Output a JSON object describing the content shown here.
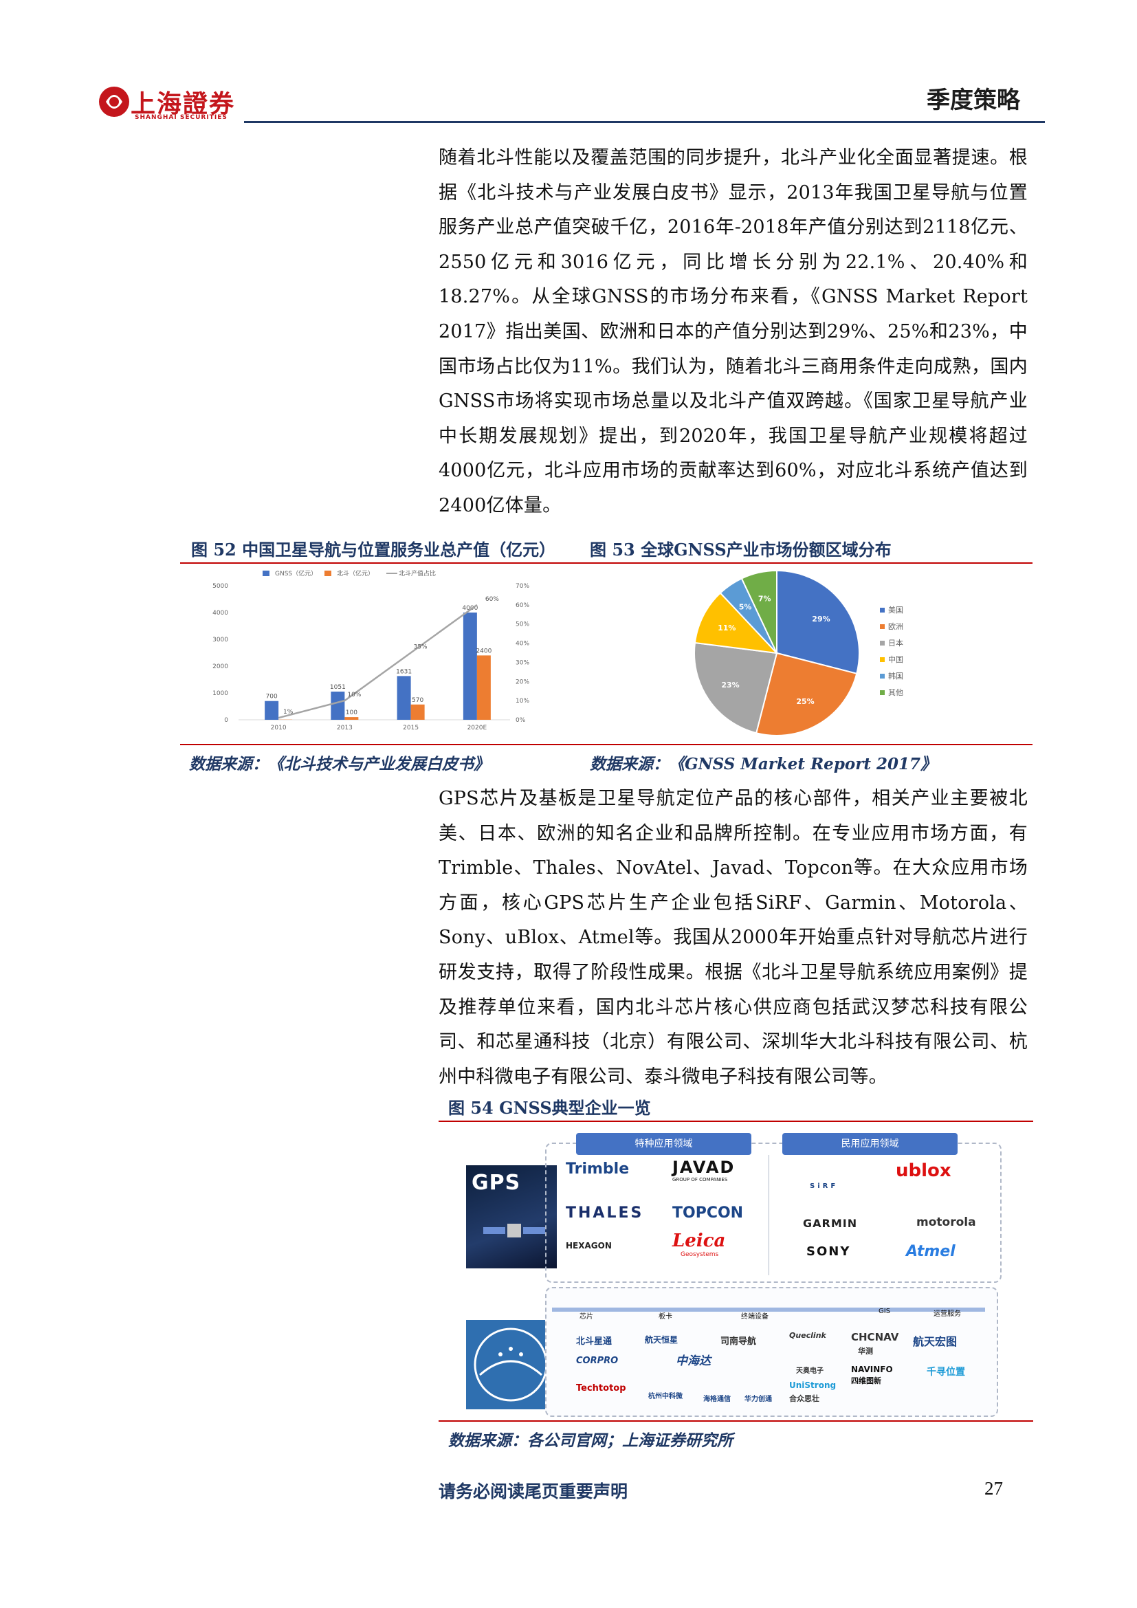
{
  "header": {
    "logo_cn": "上海證券",
    "logo_en": "SHANGHAI SECURITIES",
    "title": "季度策略"
  },
  "paragraphs": {
    "p1": "随着北斗性能以及覆盖范围的同步提升，北斗产业化全面显著提速。根据《北斗技术与产业发展白皮书》显示，2013年我国卫星导航与位置服务产业总产值突破千亿，2016年-2018年产值分别达到2118亿元、2550亿元和3016亿元，同比增长分别为22.1%、20.40%和18.27%。从全球GNSS的市场分布来看，《GNSS Market Report 2017》指出美国、欧洲和日本的产值分别达到29%、25%和23%，中国市场占比仅为11%。我们认为，随着北斗三商用条件走向成熟，国内GNSS市场将实现市场总量以及北斗产值双跨越。《国家卫星导航产业中长期发展规划》提出，到2020年，我国卫星导航产业规模将超过4000亿元，北斗应用市场的贡献率达到60%，对应北斗系统产值达到2400亿体量。",
    "p2": "GPS芯片及基板是卫星导航定位产品的核心部件，相关产业主要被北美、日本、欧洲的知名企业和品牌所控制。在专业应用市场方面，有Trimble、Thales、NovAtel、Javad、Topcon等。在大众应用市场方面，核心GPS芯片生产企业包括SiRF、Garmin、Motorola、Sony、uBlox、Atmel等。我国从2000年开始重点针对导航芯片进行研发支持，取得了阶段性成果。根据《北斗卫星导航系统应用案例》提及推荐单位来看，国内北斗芯片核心供应商包括武汉梦芯科技有限公司、和芯星通科技（北京）有限公司、深圳华大北斗科技有限公司、杭州中科微电子有限公司、泰斗微电子科技有限公司等。"
  },
  "figures": {
    "fig52_caption": "图 52 中国卫星导航与位置服务业总产值（亿元）",
    "fig53_caption": "图 53 全球GNSS产业市场份额区域分布",
    "fig52_source": "数据来源：《北斗技术与产业发展白皮书》",
    "fig53_source": "数据来源：《GNSS Market Report 2017》",
    "fig54_caption": "图 54 GNSS典型企业一览",
    "fig54_source": "数据来源：各公司官网；上海证券研究所"
  },
  "chart_data": [
    {
      "type": "bar",
      "categories": [
        "2010",
        "2013",
        "2015",
        "2020E"
      ],
      "series": [
        {
          "name": "GNSS（亿元）",
          "values": [
            700,
            1051,
            1631,
            4000
          ],
          "color": "#4472c4",
          "labels": [
            "700",
            "1051",
            "1631",
            "4000"
          ]
        },
        {
          "name": "北斗（亿元）",
          "values": [
            7,
            100,
            570,
            2400
          ],
          "color": "#ed7d31",
          "labels": [
            "",
            "100",
            "570",
            "2400"
          ]
        },
        {
          "name": "北斗产值占比",
          "type": "line",
          "axis": "right",
          "values": [
            1,
            10,
            35,
            60
          ],
          "color": "#a5a5a5",
          "labels": [
            "1%",
            "10%",
            "35%",
            "60%"
          ]
        }
      ],
      "left_ticks": [
        "5000",
        "4000",
        "3000",
        "2000",
        "1000",
        "0"
      ],
      "right_ticks": [
        "70%",
        "60%",
        "50%",
        "40%",
        "30%",
        "20%",
        "10%",
        "0%"
      ],
      "ylim": [
        0,
        5000
      ],
      "ylim_right": [
        0,
        70
      ],
      "legend": "top"
    },
    {
      "type": "pie",
      "slices": [
        {
          "name": "美国",
          "value": 29,
          "label": "29%",
          "color": "#4472c4"
        },
        {
          "name": "欧洲",
          "value": 25,
          "label": "25%",
          "color": "#ed7d31"
        },
        {
          "name": "日本",
          "value": 23,
          "label": "23%",
          "color": "#a5a5a5"
        },
        {
          "name": "中国",
          "value": 11,
          "label": "11%",
          "color": "#ffc000"
        },
        {
          "name": "韩国",
          "value": 5,
          "label": "5%",
          "color": "#5b9bd5"
        },
        {
          "name": "其他",
          "value": 7,
          "label": "7%",
          "color": "#70ad47"
        }
      ],
      "legend": "right"
    }
  ],
  "fig54": {
    "pill_special": "特种应用领域",
    "pill_civil": "民用应用领域",
    "gps_label": "GPS",
    "special_brands": [
      "Trimble",
      "JAVAD",
      "GROUP OF COMPANIES",
      "THALES",
      "TOPCON",
      "HEXAGON",
      "Leica",
      "Geosystems"
    ],
    "civil_brands": [
      "SiRF",
      "ublox",
      "GARMIN",
      "motorola",
      "SONY",
      "Atmel"
    ],
    "chain": [
      "芯片",
      "板卡",
      "终端设备",
      "GIS",
      "运营服务"
    ],
    "cn_companies": [
      "北斗星通",
      "航天恒星",
      "司南导航",
      "Queclink",
      "CHCNAV",
      "华测",
      "航天宏图",
      "CORPRO",
      "中海达",
      "NAVINFO",
      "四维图新",
      "千寻位置",
      "Techtotop",
      "杭州中科微",
      "海格通信",
      "华力创通",
      "UniStrong",
      "合众思壮",
      "天奥电子"
    ]
  },
  "footer": {
    "note": "请务必阅读尾页重要声明",
    "page": "27"
  }
}
